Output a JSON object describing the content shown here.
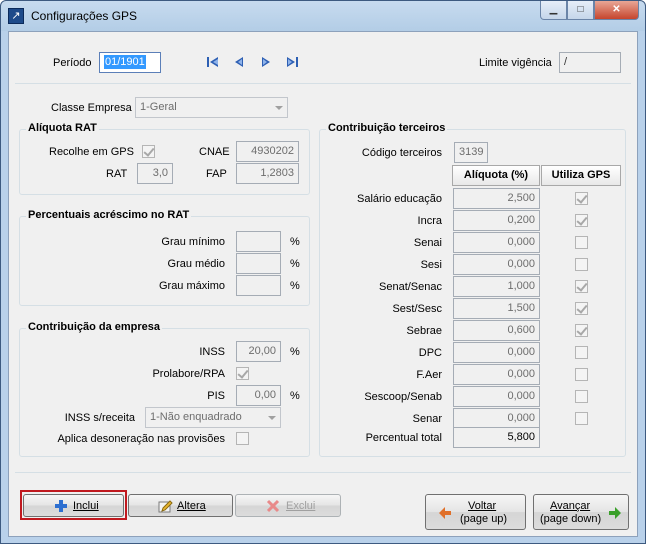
{
  "window": {
    "title": "Configurações GPS",
    "controls": {
      "minimize": "▁",
      "maximize": "□",
      "close": "✕"
    }
  },
  "header": {
    "periodo_label": "Período",
    "periodo_value": "01/1901",
    "limite_label": "Limite vigência",
    "limite_value": "/"
  },
  "classe_empresa": {
    "label": "Classe Empresa",
    "value": "1-Geral"
  },
  "aliquota_rat": {
    "title": "Alíquota RAT",
    "recolhe_label": "Recolhe em GPS",
    "recolhe_checked": true,
    "cnae_label": "CNAE",
    "cnae_value": "4930202",
    "rat_label": "RAT",
    "rat_value": "3,0",
    "fap_label": "FAP",
    "fap_value": "1,2803"
  },
  "percentuais": {
    "title": "Percentuais acréscimo no RAT",
    "rows": [
      {
        "label": "Grau mínimo",
        "value": "",
        "unit": "%"
      },
      {
        "label": "Grau médio",
        "value": "",
        "unit": "%"
      },
      {
        "label": "Grau máximo",
        "value": "",
        "unit": "%"
      }
    ]
  },
  "contribuicao_empresa": {
    "title": "Contribuição da empresa",
    "inss_label": "INSS",
    "inss_value": "20,00",
    "inss_unit": "%",
    "prolabore_label": "Prolabore/RPA",
    "prolabore_checked": true,
    "pis_label": "PIS",
    "pis_value": "0,00",
    "pis_unit": "%",
    "inss_receita_label": "INSS s/receita",
    "inss_receita_value": "1-Não enquadrado",
    "desoneracao_label": "Aplica desoneração nas provisões",
    "desoneracao_checked": false
  },
  "terceiros": {
    "title": "Contribuição terceiros",
    "codigo_label": "Código terceiros",
    "codigo_value": "3139",
    "col_aliquota": "Alíquota (%)",
    "col_utiliza": "Utiliza GPS",
    "rows": [
      {
        "label": "Salário educação",
        "value": "2,500",
        "checked": true
      },
      {
        "label": "Incra",
        "value": "0,200",
        "checked": true
      },
      {
        "label": "Senai",
        "value": "0,000",
        "checked": false
      },
      {
        "label": "Sesi",
        "value": "0,000",
        "checked": false
      },
      {
        "label": "Senat/Senac",
        "value": "1,000",
        "checked": true
      },
      {
        "label": "Sest/Sesc",
        "value": "1,500",
        "checked": true
      },
      {
        "label": "Sebrae",
        "value": "0,600",
        "checked": true
      },
      {
        "label": "DPC",
        "value": "0,000",
        "checked": false
      },
      {
        "label": "F.Aer",
        "value": "0,000",
        "checked": false
      },
      {
        "label": "Sescoop/Senab",
        "value": "0,000",
        "checked": false
      },
      {
        "label": "Senar",
        "value": "0,000",
        "checked": false
      }
    ],
    "total_label": "Percentual total",
    "total_value": "5,800"
  },
  "buttons": {
    "inclui": "Inclui",
    "altera": "Altera",
    "exclui": "Exclui",
    "voltar_line1": "Voltar",
    "voltar_line2": "(page up)",
    "avancar_line1": "Avançar",
    "avancar_line2": "(page down)"
  },
  "colors": {
    "accent_blue": "#3399ff",
    "highlight_red": "#c0191f",
    "nav_arrow_blue": "#2d5fb3",
    "exclui_disabled_red": "#e88a8a",
    "arrow_orange": "#e0702a",
    "arrow_green": "#3aa02a"
  }
}
